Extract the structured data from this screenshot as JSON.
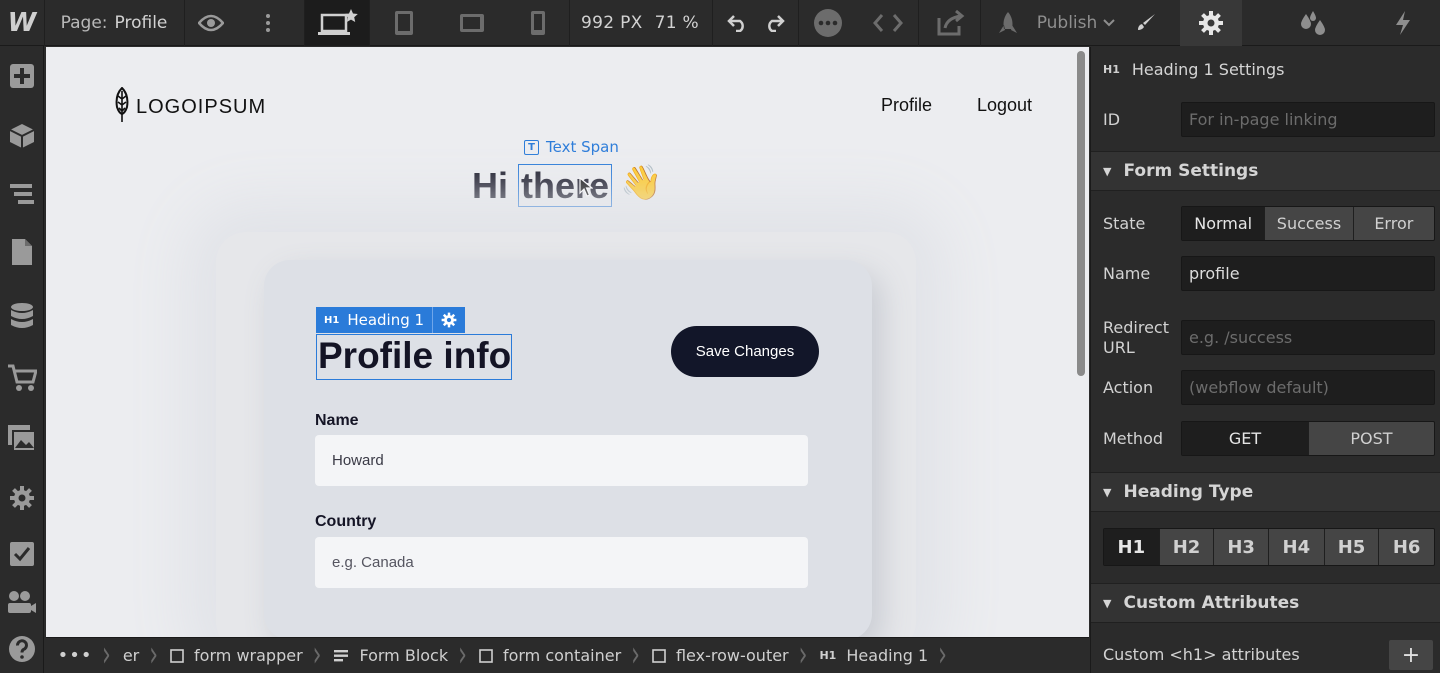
{
  "topbar": {
    "logo": "W",
    "page_label": "Page:",
    "page_name": "Profile",
    "canvas_width": "992 PX",
    "zoom": "71 %",
    "publish_label": "Publish"
  },
  "canvas": {
    "site_logo_text": "LOGOIPSUM",
    "nav": [
      "Profile",
      "Logout"
    ],
    "text_span_label": "Text Span",
    "greeting_prefix": "Hi ",
    "greeting_highlight": "there",
    "wave_emoji": "👋",
    "h1_tag_level": "H1",
    "h1_tag_label": "Heading 1",
    "heading": "Profile info",
    "save_button": "Save Changes",
    "fields": [
      {
        "label": "Name",
        "value": "Howard"
      },
      {
        "label": "Country",
        "placeholder": "e.g. Canada"
      }
    ]
  },
  "breadcrumbs": {
    "overflow": "•••",
    "items": [
      "er",
      "form wrapper",
      "Form Block",
      "form container",
      "flex-row-outer",
      "Heading 1"
    ],
    "last_level": "H1"
  },
  "panel": {
    "settings_level": "H1",
    "settings_title": "Heading 1 Settings",
    "id_label": "ID",
    "id_placeholder": "For in-page linking",
    "form_settings": "Form Settings",
    "state_label": "State",
    "states": [
      "Normal",
      "Success",
      "Error"
    ],
    "name_label": "Name",
    "name_value": "profile",
    "redirect_label_1": "Redirect",
    "redirect_label_2": "URL",
    "redirect_placeholder": "e.g. /success",
    "action_label": "Action",
    "action_placeholder": "(webflow default)",
    "method_label": "Method",
    "methods": [
      "GET",
      "POST"
    ],
    "heading_type": "Heading Type",
    "heading_levels": [
      "H1",
      "H2",
      "H3",
      "H4",
      "H5",
      "H6"
    ],
    "custom_attributes": "Custom Attributes",
    "custom_attr_text": "Custom <h1> attributes",
    "add_symbol": "+"
  },
  "icons": {
    "topbar": [
      "eye-icon",
      "more-vertical-icon",
      "desktop-star-icon",
      "tablet-icon",
      "tablet-landscape-icon",
      "mobile-icon",
      "undo-icon",
      "redo-icon",
      "more-circle-icon",
      "code-icon",
      "export-icon",
      "rocket-icon",
      "brush-icon",
      "gear-icon",
      "drops-icon",
      "lightning-icon"
    ],
    "sidebar": [
      "add-icon",
      "box-icon",
      "navigator-icon",
      "pages-icon",
      "cms-icon",
      "cart-icon",
      "assets-icon",
      "settings-icon",
      "audit-icon",
      "users-icon",
      "help-icon"
    ]
  },
  "colors": {
    "selection": "#2a7bd9",
    "panel_bg": "#2b2b2b",
    "canvas_bg": "#ecedf0",
    "button_dark": "#121629"
  }
}
